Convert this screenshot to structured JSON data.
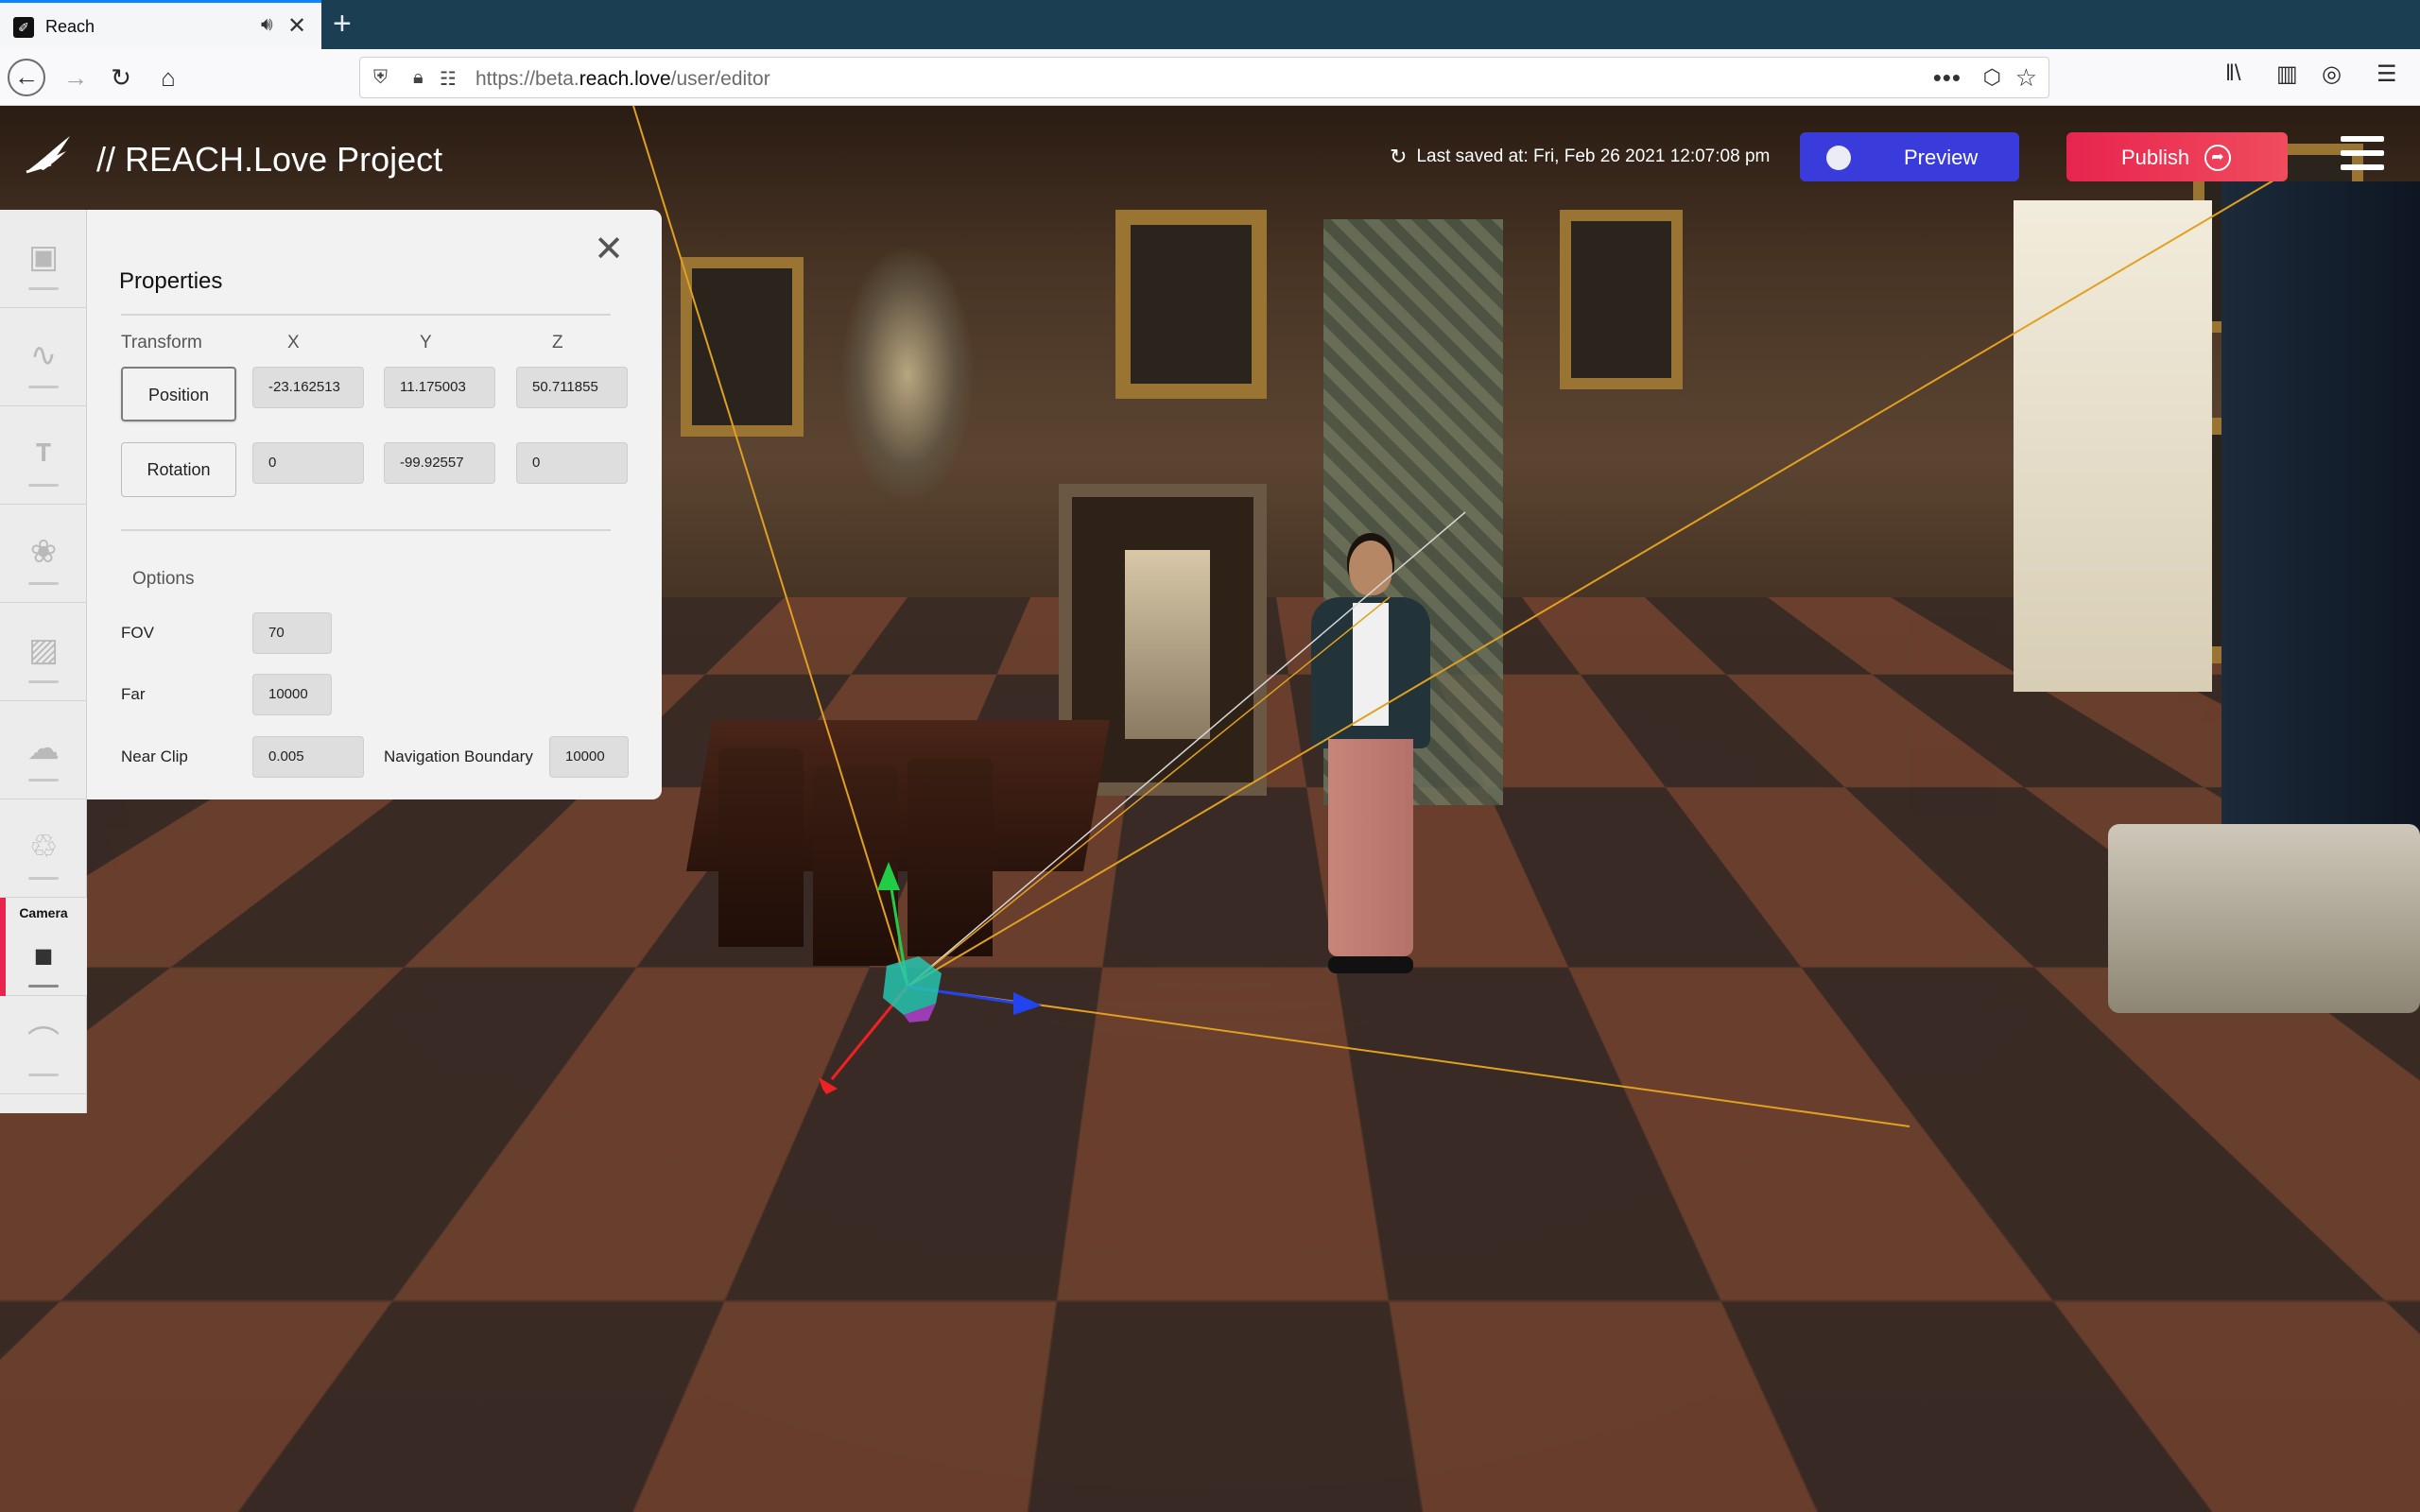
{
  "browser": {
    "tab_title": "Reach",
    "url_prefix": "https://beta.",
    "url_domain": "reach.love",
    "url_path": "/user/editor"
  },
  "app": {
    "title": "// REACH.Love Project",
    "last_saved": "Last saved at: Fri, Feb 26 2021 12:07:08 pm",
    "preview_label": "Preview",
    "publish_label": "Publish"
  },
  "toolstrip": {
    "items": [
      {
        "name": "avatar",
        "icon": "person-icon"
      },
      {
        "name": "audio",
        "icon": "waveform-icon"
      },
      {
        "name": "text",
        "icon": "text-icon"
      },
      {
        "name": "logo",
        "icon": "logo-icon"
      },
      {
        "name": "object",
        "icon": "cube-icon"
      },
      {
        "name": "sky",
        "icon": "cloud-icon"
      },
      {
        "name": "light",
        "icon": "lightbulb-icon"
      },
      {
        "name": "camera",
        "icon": "camera-icon",
        "label": "Camera",
        "active": true
      },
      {
        "name": "environment",
        "icon": "shell-icon"
      }
    ]
  },
  "properties": {
    "title": "Properties",
    "transform_label": "Transform",
    "x_label": "X",
    "y_label": "Y",
    "z_label": "Z",
    "position_label": "Position",
    "position": {
      "x": "-23.162513",
      "y": "11.175003",
      "z": "50.711855"
    },
    "rotation_label": "Rotation",
    "rotation": {
      "x": "0",
      "y": "-99.92557",
      "z": "0"
    },
    "options_label": "Options",
    "fov_label": "FOV",
    "fov": "70",
    "far_label": "Far",
    "far": "10000",
    "near_clip_label": "Near Clip",
    "near_clip": "0.005",
    "nav_boundary_label": "Navigation Boundary",
    "nav_boundary": "10000"
  },
  "colors": {
    "accent_preview": "#3a3bdb",
    "accent_publish": "#e8244e",
    "browser_tab_accent": "#0a84ff"
  }
}
